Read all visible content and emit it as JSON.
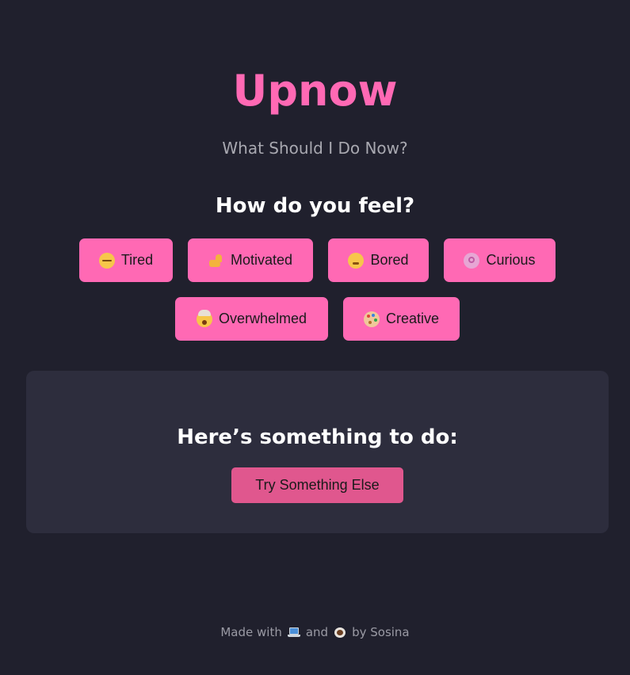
{
  "header": {
    "title": "Upnow",
    "subtitle": "What Should I Do Now?"
  },
  "mood": {
    "prompt": "How do you feel?",
    "options": [
      {
        "label": "Tired",
        "icon": "sleeping-face-icon"
      },
      {
        "label": "Motivated",
        "icon": "flexed-biceps-icon"
      },
      {
        "label": "Bored",
        "icon": "flushed-face-icon"
      },
      {
        "label": "Curious",
        "icon": "brain-icon"
      },
      {
        "label": "Overwhelmed",
        "icon": "exploding-head-icon"
      },
      {
        "label": "Creative",
        "icon": "artist-palette-icon"
      }
    ]
  },
  "suggestion": {
    "title": "Here’s something to do:",
    "button_label": "Try Something Else"
  },
  "footer": {
    "prefix": "Made with",
    "icon1": "laptop-icon",
    "conjunction": "and",
    "icon2": "coffee-icon",
    "suffix": "by Sosina"
  },
  "colors": {
    "background": "#20202d",
    "accent": "#ff69b4",
    "card": "#2d2d3d",
    "secondary_button": "#e0578e"
  }
}
